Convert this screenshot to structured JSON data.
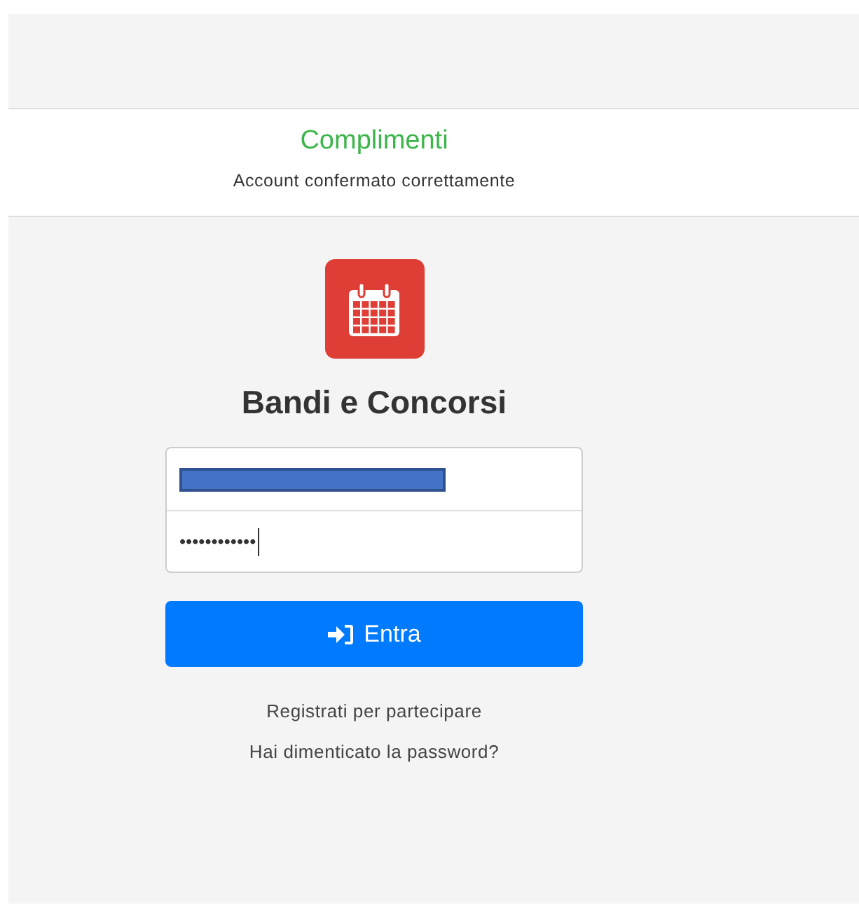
{
  "banner": {
    "title": "Complimenti",
    "message": "Account confermato correttamente"
  },
  "app": {
    "title": "Bandi e Concorsi"
  },
  "login": {
    "fields": [
      {
        "kind": "redacted",
        "focused": false
      },
      {
        "kind": "password",
        "value": "••••••••••••",
        "focused": true
      }
    ],
    "submit": {
      "label": "Entra"
    },
    "links": [
      "Registrati per partecipare",
      "Hai dimenticato la password?"
    ]
  }
}
